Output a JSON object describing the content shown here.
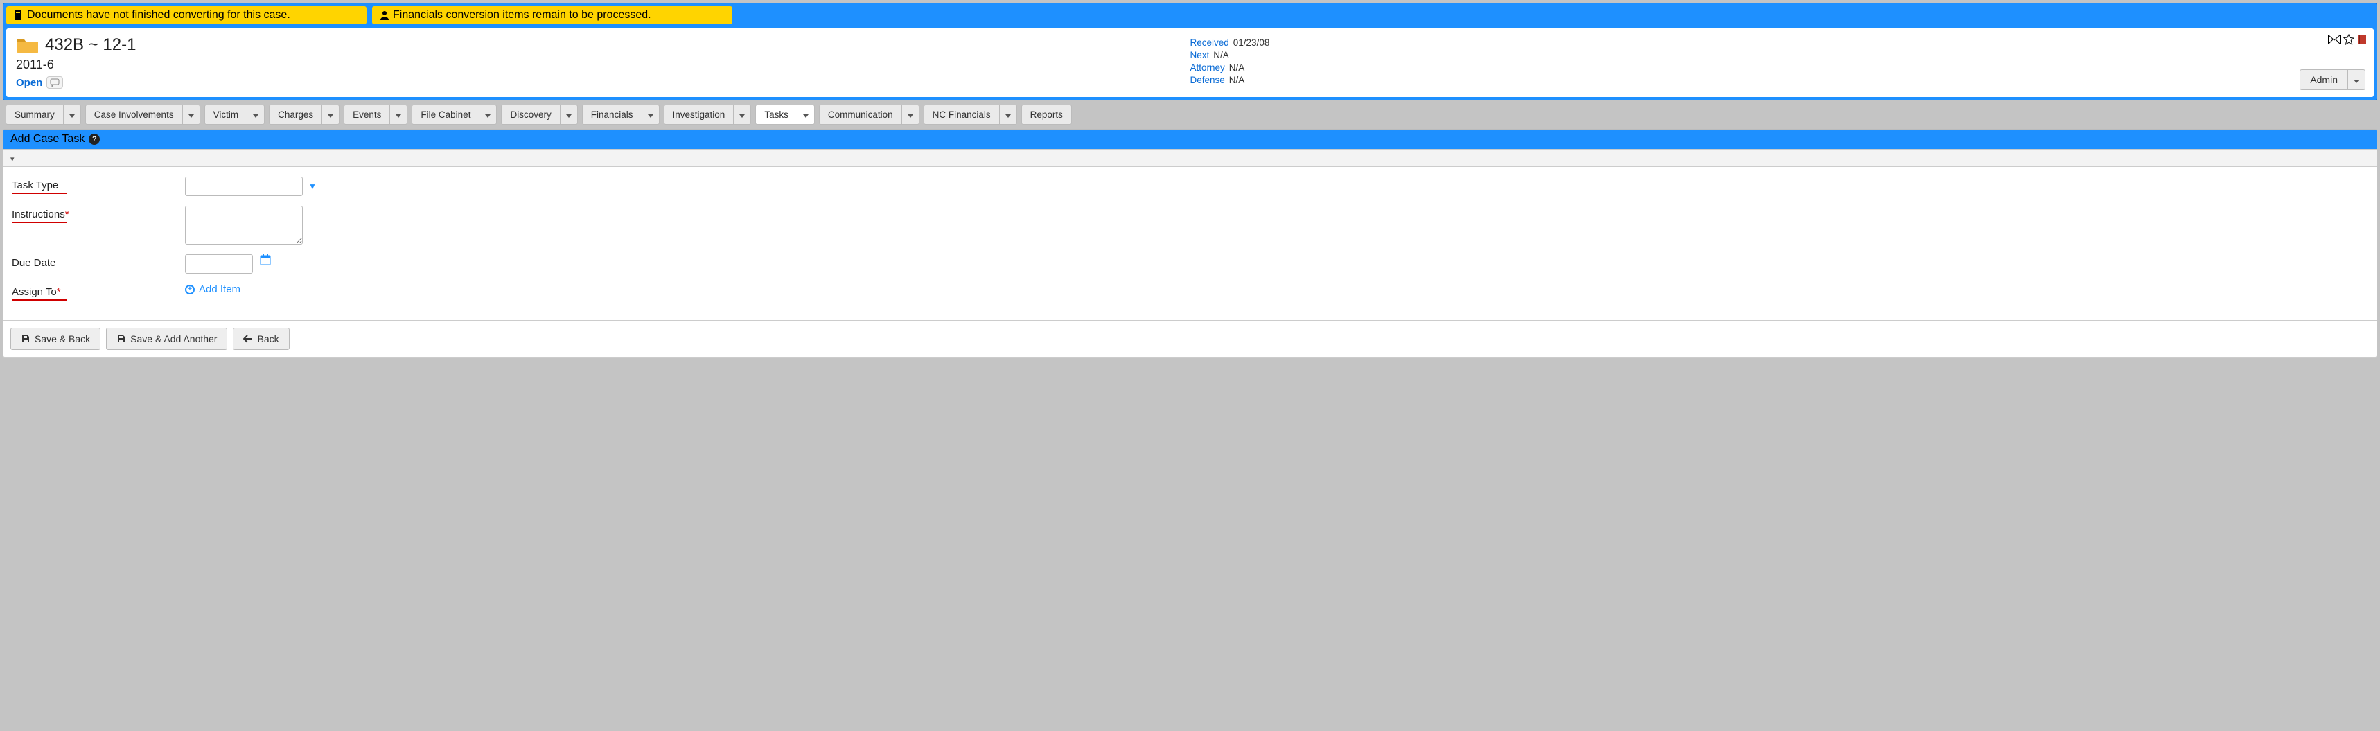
{
  "alerts": {
    "doc": "Documents have not finished converting for this case.",
    "fin": "Financials conversion items remain to be processed."
  },
  "case": {
    "title": "432B ~ 12-1",
    "subtitle": "2011-6",
    "status": "Open",
    "meta": {
      "received_label": "Received",
      "received_val": "01/23/08",
      "next_label": "Next",
      "next_val": "N/A",
      "attorney_label": "Attorney",
      "attorney_val": "N/A",
      "defense_label": "Defense",
      "defense_val": "N/A"
    },
    "admin": "Admin"
  },
  "tabs": {
    "summary": "Summary",
    "involvements": "Case Involvements",
    "victim": "Victim",
    "charges": "Charges",
    "events": "Events",
    "filecab": "File Cabinet",
    "discovery": "Discovery",
    "financials": "Financials",
    "investigation": "Investigation",
    "tasks": "Tasks",
    "communication": "Communication",
    "ncfin": "NC Financials",
    "reports": "Reports"
  },
  "section": {
    "title": "Add Case Task"
  },
  "form": {
    "task_type_label": "Task Type",
    "instructions_label": "Instructions",
    "due_date_label": "Due Date",
    "assign_to_label": "Assign To",
    "add_item": "Add Item"
  },
  "buttons": {
    "save_back": "Save & Back",
    "save_add": "Save & Add Another",
    "back": "Back"
  }
}
